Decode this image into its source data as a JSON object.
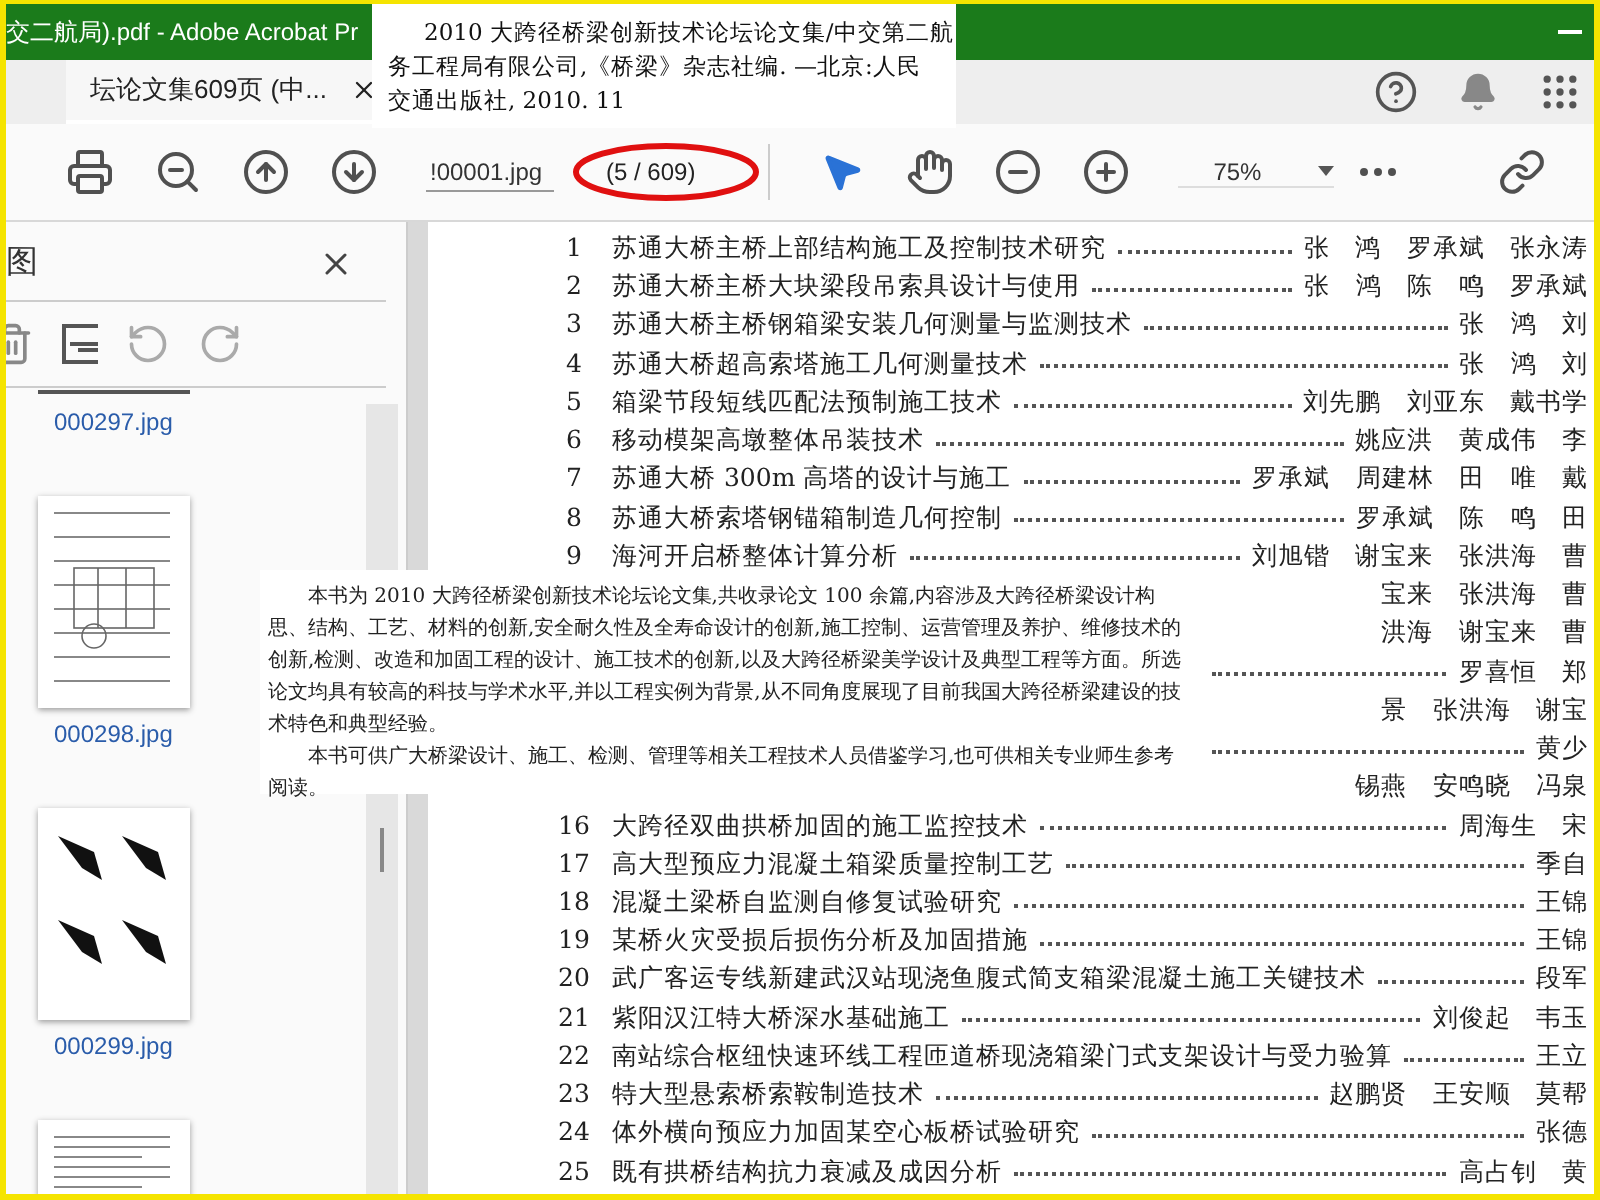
{
  "window": {
    "title": "交二航局).pdf - Adobe Acrobat Pr"
  },
  "citation_overlay": {
    "lines": [
      "2010 大跨径桥梁创新技术论坛论文集/中交第二航",
      "务工程局有限公司,《桥梁》杂志社编. —北京:人民",
      "交通出版社, 2010. 11"
    ]
  },
  "tabs": [
    {
      "label": "坛论文集609页 (中...",
      "selected": true
    }
  ],
  "toolbar": {
    "page_field": "!00001.jpg",
    "page_count": "(5 / 609)",
    "zoom": "75%"
  },
  "sidebar": {
    "title": "图",
    "thumbnails": [
      {
        "kind": "edge",
        "label": "000297.jpg"
      },
      {
        "kind": "drawing",
        "label": "000298.jpg"
      },
      {
        "kind": "figures",
        "label": "000299.jpg"
      },
      {
        "kind": "text"
      }
    ]
  },
  "document": {
    "entries": [
      {
        "kind": "entry",
        "number": "1",
        "title": "苏通大桥主桥上部结构施工及控制技术研究",
        "authors": "张 鸿 罗承斌 张永涛"
      },
      {
        "kind": "entry",
        "number": "2",
        "title": "苏通大桥主桥大块梁段吊索具设计与使用",
        "authors": "张 鸿 陈 鸣 罗承斌"
      },
      {
        "kind": "entry",
        "number": "3",
        "title": "苏通大桥主桥钢箱梁安装几何测量与监测技术",
        "authors": "张 鸿 刘"
      },
      {
        "kind": "entry",
        "number": "4",
        "title": "苏通大桥超高索塔施工几何测量技术",
        "authors": "张 鸿 刘"
      },
      {
        "kind": "entry",
        "number": "5",
        "title": "箱梁节段短线匹配法预制施工技术",
        "authors": "刘先鹏 刘亚东 戴书学"
      },
      {
        "kind": "entry",
        "number": "6",
        "title": "移动模架高墩整体吊装技术",
        "authors": "姚应洪 黄成伟 李"
      },
      {
        "kind": "entry",
        "number": "7",
        "title": "苏通大桥 300m 高塔的设计与施工",
        "authors": "罗承斌 周建林 田 唯 戴"
      },
      {
        "kind": "entry",
        "number": "8",
        "title": "苏通大桥索塔钢锚箱制造几何控制",
        "authors": "罗承斌 陈 鸣 田"
      },
      {
        "kind": "entry",
        "number": "9",
        "title": "海河开启桥整体计算分析",
        "authors": "刘旭锴 谢宝来 张洪海 曹"
      },
      {
        "kind": "fragment",
        "dotted": false,
        "authors": "宝来 张洪海 曹"
      },
      {
        "kind": "fragment",
        "dotted": false,
        "authors": "洪海 谢宝来 曹"
      },
      {
        "kind": "fragment",
        "dotted": true,
        "authors": "罗喜恒 郑"
      },
      {
        "kind": "fragment",
        "dotted": false,
        "authors": "景 张洪海 谢宝"
      },
      {
        "kind": "fragment",
        "dotted": true,
        "authors": "黄少"
      },
      {
        "kind": "fragment",
        "dotted": false,
        "authors": "锡燕 安鸣晓 冯泉"
      },
      {
        "kind": "entry",
        "number": "16",
        "title": "大跨径双曲拱桥加固的施工监控技术",
        "authors": "周海生 宋"
      },
      {
        "kind": "entry",
        "number": "17",
        "title": "高大型预应力混凝土箱梁质量控制工艺",
        "authors": "季自"
      },
      {
        "kind": "entry",
        "number": "18",
        "title": "混凝土梁桥自监测自修复试验研究",
        "authors": "王锦"
      },
      {
        "kind": "entry",
        "number": "19",
        "title": "某桥火灾受损后损伤分析及加固措施",
        "authors": "王锦"
      },
      {
        "kind": "entry",
        "number": "20",
        "title": "武广客运专线新建武汉站现浇鱼腹式简支箱梁混凝土施工关键技术",
        "authors": "段军"
      },
      {
        "kind": "entry",
        "number": "21",
        "title": "紫阳汉江特大桥深水基础施工",
        "authors": "刘俊起 韦玉"
      },
      {
        "kind": "entry",
        "number": "22",
        "title": "南站综合枢纽快速环线工程匝道桥现浇箱梁门式支架设计与受力验算",
        "authors": "王立"
      },
      {
        "kind": "entry",
        "number": "23",
        "title": "特大型悬索桥索鞍制造技术",
        "authors": "赵鹏贤 王安顺 莫帮"
      },
      {
        "kind": "entry",
        "number": "24",
        "title": "体外横向预应力加固某空心板桥试验研究",
        "authors": "张德"
      },
      {
        "kind": "entry",
        "number": "25",
        "title": "既有拱桥结构抗力衰减及成因分析",
        "authors": "高占钊 黄"
      }
    ]
  },
  "summary_overlay": {
    "paragraphs": [
      "本书为 2010 大跨径桥梁创新技术论坛论文集,共收录论文 100 余篇,内容涉及大跨径桥梁设计构思、结构、工艺、材料的创新,安全耐久性及全寿命设计的创新,施工控制、运营管理及养护、维修技术的创新,检测、改造和加固工程的设计、施工技术的创新,以及大跨径桥梁美学设计及典型工程等方面。所选论文均具有较高的科技与学术水平,并以工程实例为背景,从不同角度展现了目前我国大跨径桥梁建设的技术特色和典型经验。",
      "本书可供广大桥梁设计、施工、检测、管理等相关工程技术人员借鉴学习,也可供相关专业师生参考阅读。"
    ]
  }
}
